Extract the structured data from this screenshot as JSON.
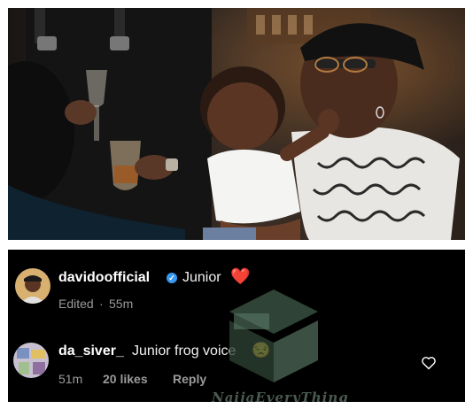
{
  "comments": [
    {
      "username": "davidoofficial",
      "text": "Junior",
      "emoji": "❤️",
      "edited": "Edited",
      "time": "55m"
    },
    {
      "username": "da_siver_",
      "text": "Junior frog voice",
      "emoji": "😒",
      "time": "51m",
      "likes": "20 likes",
      "reply": "Reply"
    }
  ],
  "watermark": {
    "text": "NaijaEveryThing"
  },
  "colors": {
    "background": "#000000",
    "username": "#ffffff",
    "meta": "#9a9a9a",
    "verified": "#3897f0",
    "heart": "#e0213a"
  },
  "icons": [
    "verified-badge-icon",
    "heart-emoji-icon",
    "like-heart-icon",
    "watermark-logo-icon"
  ]
}
